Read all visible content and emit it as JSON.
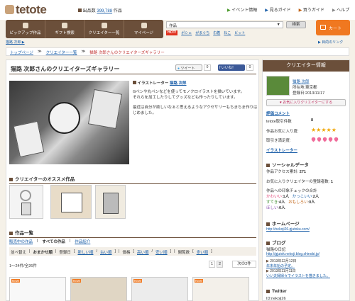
{
  "brand": {
    "logo": "tetote",
    "exhibitors_label": "出品数",
    "exhibitors_count": "399,788",
    "exhibitors_unit": "作品"
  },
  "top_links": [
    "イベント情報",
    "見るガイド",
    "買うガイド",
    "ヘルプ"
  ],
  "nav_tabs": [
    "ピックアップ作品",
    "ギフト検索",
    "クリエイター一覧",
    "マイページ"
  ],
  "search": {
    "category": "作品",
    "button": "検索"
  },
  "hot_tags": {
    "label": "HOT!",
    "tags": [
      "ポシェ",
      "がまぐち",
      "巾着",
      "ねこ",
      "ビット"
    ]
  },
  "cart": {
    "label": "カート"
  },
  "userbar": {
    "left": "猫路 次郎 ▶",
    "right": "▶ 目的のリンク"
  },
  "breadcrumb": [
    "トップページ",
    "クリエイター一覧",
    "猫路 次郎さんのクリエイターズギャラリー"
  ],
  "gallery": {
    "title": "猫路 次郎さんのクリエイターズギャラリー",
    "tweet": "ツイート",
    "tweet_count": "0",
    "like": "いいね！",
    "like_count": "0"
  },
  "profile": {
    "role_label": "イラストレーター",
    "name": "猫路 次郎",
    "lines": [
      "Gペンや丸ペンなどを使ってモノクロイラストを描いています。",
      "それらを加工したりしてグッズなども作ったりしています。",
      "",
      "最近は自分が欲しいなぁと思えるようなアクセサリーもちまちま作りはじめました。"
    ]
  },
  "recommend": {
    "heading": "クリエイターのオススメ作品"
  },
  "works": {
    "heading": "作品一覧",
    "tabs": [
      "販売中の作品",
      "すべての作品",
      "作品紹介"
    ],
    "sort_label": "並べ替え",
    "sort_items": [
      "おまかせ順",
      "登録日",
      "新しい順",
      "古い順",
      "価格",
      "高い順",
      "安い順",
      "閲覧数",
      "多い順"
    ],
    "range": "1〜24件/全26件",
    "pages": [
      "1",
      "2"
    ],
    "next": "次の2件",
    "new_badge": "New!"
  },
  "sidebar": {
    "header": "クリエイター情報",
    "name": "猫路 次郎",
    "location": "所在地:東京都",
    "joined": "登録日:2013/11/17",
    "fav_button": "♥ お気に入りクリエイターにする",
    "review_label": "評価コメント",
    "tetote_count_label": "tetote取引件数",
    "tetote_count": "8",
    "satisfaction_label": "作品お気に入り度:",
    "satisfaction_stars": 5,
    "hearts_label": "取引き満足度:",
    "hearts": 5,
    "illustrator_label": "イラストレーター",
    "social_heading": "ソーシャルデータ",
    "access_label": "作品アクセス累計:",
    "access_count": "271",
    "fav_users_label": "お気に入りクリエイターの登録者数:",
    "fav_users_count": "1",
    "impression_label": "作品への印象チェックの合計",
    "impressions": [
      {
        "k": "かわいい",
        "v": "1人",
        "color": "#e34b7a"
      },
      {
        "k": "かっこいい",
        "v": "2人",
        "color": "#1a5ea8"
      },
      {
        "k": "すてき",
        "v": "4人",
        "color": "#3a8a2a"
      },
      {
        "k": "おもしろい",
        "v": "0人",
        "color": "#c06010"
      },
      {
        "k": "ほしい",
        "v": "0人",
        "color": "#8a50b0"
      }
    ],
    "homepage_heading": "ホームページ",
    "homepage_url": "http://nekoji26.gjutoku.com/",
    "blog_heading": "ブログ",
    "blog_title": "猫路の日記",
    "blog_url": "http://gjutok.nekoji.blog.shinobi.jp/",
    "blog_posts": [
      {
        "date": "2013年12月12日",
        "title": "年末年始の予定。"
      },
      {
        "date": "2013年11月11日",
        "title": "いい夫婦婦々でイラストを描きました。"
      }
    ],
    "twitter_heading": "Twitter",
    "twitter_id": "ID:nekoji26"
  }
}
